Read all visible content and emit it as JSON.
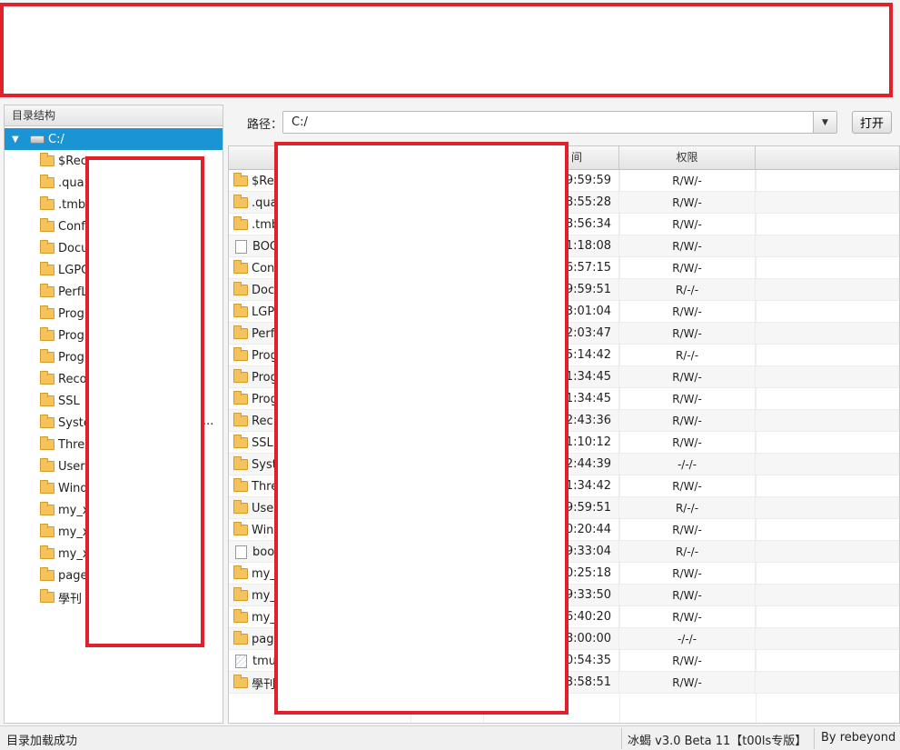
{
  "tree": {
    "header": "目录结构",
    "root": "C:/",
    "items": [
      {
        "label": "$Rec",
        "icon": "folder"
      },
      {
        "label": ".qua",
        "icon": "folder"
      },
      {
        "label": ".tmb",
        "icon": "folder"
      },
      {
        "label": "Conf",
        "icon": "folder"
      },
      {
        "label": "Docu",
        "icon": "folder"
      },
      {
        "label": "LGPC",
        "icon": "folder"
      },
      {
        "label": "PerfL",
        "icon": "folder"
      },
      {
        "label": "Progr",
        "icon": "folder"
      },
      {
        "label": "Progr",
        "icon": "folder"
      },
      {
        "label": "Progr",
        "icon": "folder"
      },
      {
        "label": "Reco",
        "icon": "folder"
      },
      {
        "label": "SSL",
        "icon": "folder"
      },
      {
        "label": "Syste",
        "icon": "folder"
      },
      {
        "label": "Threa",
        "icon": "folder"
      },
      {
        "label": "Users",
        "icon": "folder"
      },
      {
        "label": "Wind",
        "icon": "folder"
      },
      {
        "label": "my_x",
        "icon": "folder"
      },
      {
        "label": "my_x",
        "icon": "folder"
      },
      {
        "label": "my_x",
        "icon": "folder"
      },
      {
        "label": "page",
        "icon": "folder"
      },
      {
        "label": "學刊",
        "icon": "folder"
      }
    ],
    "overflow_ellipsis": "..."
  },
  "pathbar": {
    "label": "路径：",
    "value": "C:/",
    "open_button": "打开"
  },
  "table": {
    "header_time_fragment": "间",
    "header_perm": "权限",
    "rows": [
      {
        "name": "$Re",
        "icon": "folder",
        "time": "9:59:59",
        "perm": "R/W/-"
      },
      {
        "name": ".qua",
        "icon": "folder",
        "time": "8:55:28",
        "perm": "R/W/-"
      },
      {
        "name": ".tmb",
        "icon": "folder",
        "time": "8:56:34",
        "perm": "R/W/-"
      },
      {
        "name": "BOO",
        "icon": "file",
        "time": "1:18:08",
        "perm": "R/W/-"
      },
      {
        "name": "Con",
        "icon": "folder",
        "time": "6:57:15",
        "perm": "R/W/-"
      },
      {
        "name": "Doc",
        "icon": "folder",
        "time": "9:59:51",
        "perm": "R/-/-"
      },
      {
        "name": "LGP",
        "icon": "folder",
        "time": "3:01:04",
        "perm": "R/W/-"
      },
      {
        "name": "Perf",
        "icon": "folder",
        "time": "2:03:47",
        "perm": "R/W/-"
      },
      {
        "name": "Prog",
        "icon": "folder",
        "time": "5:14:42",
        "perm": "R/-/-"
      },
      {
        "name": "Prog",
        "icon": "folder",
        "time": "1:34:45",
        "perm": "R/W/-"
      },
      {
        "name": "Prog",
        "icon": "folder",
        "time": "1:34:45",
        "perm": "R/W/-"
      },
      {
        "name": "Rec",
        "icon": "folder",
        "time": "2:43:36",
        "perm": "R/W/-"
      },
      {
        "name": "SSL",
        "icon": "folder",
        "time": "1:10:12",
        "perm": "R/W/-"
      },
      {
        "name": "Syst",
        "icon": "folder",
        "time": "2:44:39",
        "perm": "-/-/-"
      },
      {
        "name": "Thre",
        "icon": "folder",
        "time": "1:34:42",
        "perm": "R/W/-"
      },
      {
        "name": "Use",
        "icon": "folder",
        "time": "9:59:51",
        "perm": "R/-/-"
      },
      {
        "name": "Win",
        "icon": "folder",
        "time": "0:20:44",
        "perm": "R/W/-"
      },
      {
        "name": "boot",
        "icon": "file",
        "time": "9:33:04",
        "perm": "R/-/-"
      },
      {
        "name": "my_",
        "icon": "folder",
        "time": "0:25:18",
        "perm": "R/W/-"
      },
      {
        "name": "my_",
        "icon": "folder",
        "time": "9:33:50",
        "perm": "R/W/-"
      },
      {
        "name": "my_",
        "icon": "folder",
        "time": "6:40:20",
        "perm": "R/W/-"
      },
      {
        "name": "page",
        "icon": "folder",
        "time": "8:00:00",
        "perm": "-/-/-"
      },
      {
        "name": "tmu",
        "icon": "special-file",
        "time": "0:54:35",
        "perm": "R/W/-"
      },
      {
        "name": "學刊",
        "icon": "folder",
        "time": "3:58:51",
        "perm": "R/W/-"
      }
    ]
  },
  "status": {
    "left": "目录加载成功",
    "version": "冰蝎 v3.0 Beta 11【t00ls专版】",
    "author": "By rebeyond"
  },
  "colors": {
    "selection": "#1b94d3",
    "redaction_border": "#e2202a",
    "folder": "#f6c25b"
  }
}
